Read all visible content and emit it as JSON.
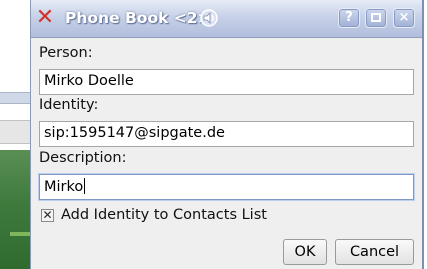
{
  "window": {
    "title": "Phone Book <2>",
    "app_icon": "x-app-icon",
    "sound_icon": "sound-icon",
    "help_label": "?",
    "close_label": "×"
  },
  "form": {
    "person_label": "Person:",
    "person_value": "Mirko Doelle",
    "identity_label": "Identity:",
    "identity_value": "sip:1595147@sipgate.de",
    "description_label": "Description:",
    "description_value": "Mirko"
  },
  "options": {
    "add_to_contacts_label": "Add Identity to Contacts List",
    "add_to_contacts_checked": true
  },
  "buttons": {
    "ok_label": "OK",
    "cancel_label": "Cancel"
  }
}
